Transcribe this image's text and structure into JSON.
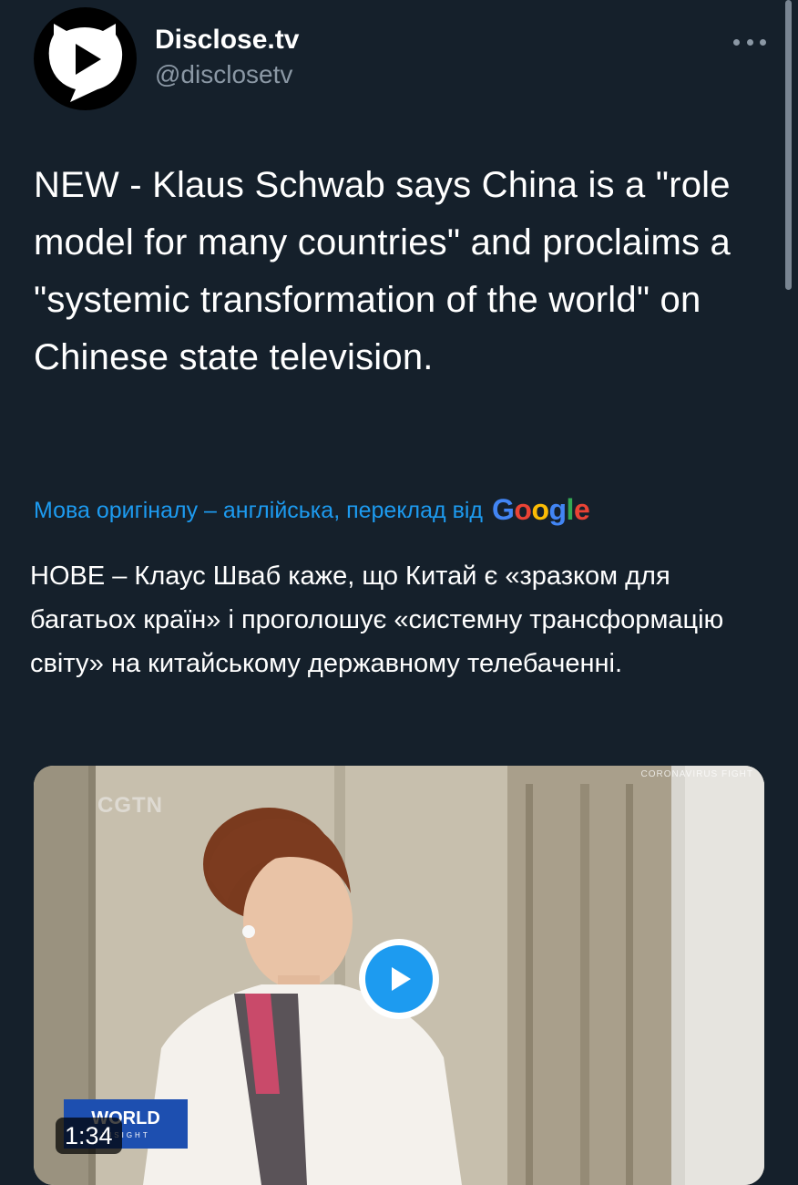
{
  "author": {
    "display_name": "Disclose.tv",
    "handle": "@disclosetv",
    "avatar_icon": "play-speech-bubble-cat-icon"
  },
  "more_icon": "more-dots-icon",
  "tweet": {
    "text": "NEW - Klaus Schwab says China is a \"role model for many countries\" and proclaims a \"systemic transformation of the world\" on Chinese state television."
  },
  "translation": {
    "label": "Мова оригіналу – англійська, переклад від",
    "provider": [
      "G",
      "o",
      "o",
      "g",
      "l",
      "e"
    ],
    "text": "НОВЕ – Клаус Шваб каже, що Китай є «зразком для багатьох країн» і проголошує «системну трансформацію світу» на китайському державному телебаченні."
  },
  "video": {
    "duration": "1:34",
    "watermark": "CGTN",
    "badge_title": "WORLD",
    "badge_subtitle": "INSIGHT",
    "corner_caption": "CORONAVIRUS FIGHT",
    "play_icon": "play-icon"
  },
  "colors": {
    "background": "#15202b",
    "text": "#ffffff",
    "secondary": "#8b98a5",
    "accent": "#1d9bf0"
  }
}
